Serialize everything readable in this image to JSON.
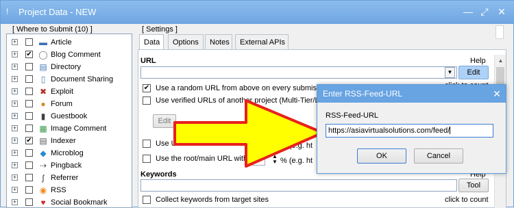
{
  "window": {
    "title": "Project Data - NEW"
  },
  "left_panel": {
    "title": "[ Where to Submit  (10) ]",
    "items": [
      {
        "label": "Article",
        "checked": false,
        "icon": "article-icon"
      },
      {
        "label": "Blog Comment",
        "checked": true,
        "icon": "comment-bubble-icon"
      },
      {
        "label": "Directory",
        "checked": false,
        "icon": "directory-icon"
      },
      {
        "label": "Document Sharing",
        "checked": false,
        "icon": "document-icon"
      },
      {
        "label": "Exploit",
        "checked": false,
        "icon": "exploit-icon"
      },
      {
        "label": "Forum",
        "checked": false,
        "icon": "forum-users-icon"
      },
      {
        "label": "Guestbook",
        "checked": false,
        "icon": "guestbook-icon"
      },
      {
        "label": "Image Comment",
        "checked": false,
        "icon": "image-icon"
      },
      {
        "label": "Indexer",
        "checked": true,
        "icon": "indexer-icon"
      },
      {
        "label": "Microblog",
        "checked": false,
        "icon": "microblog-icon"
      },
      {
        "label": "Pingback",
        "checked": false,
        "icon": "pingback-icon"
      },
      {
        "label": "Referrer",
        "checked": false,
        "icon": "referrer-icon"
      },
      {
        "label": "RSS",
        "checked": false,
        "icon": "rss-icon"
      },
      {
        "label": "Social Bookmark",
        "checked": false,
        "icon": "bookmark-icon"
      }
    ]
  },
  "settings": {
    "title": "[ Settings ]",
    "tabs": [
      "Data",
      "Options",
      "Notes",
      "External APIs"
    ],
    "url_label": "URL",
    "help_1": "Help",
    "edit_button": "Edit",
    "click_to_count_1": "click to count",
    "opt_random_url": "Use a random URL from above on every submissi",
    "opt_verified_urls": "Use verified URLs of another project (Multi-Tier/L",
    "edit_button_2": "Edit",
    "opt_url_variations": "Use U",
    "opt_url_variations_tail": "with",
    "pct_hint_1": "% (e.g. ht",
    "opt_root_url": "Use the root/main URL with",
    "root_pct": "30",
    "pct_hint_2": "% (e.g. ht",
    "keywords_label": "Keywords",
    "help_2": "Help",
    "tool_button": "Tool",
    "opt_collect_keywords": "Collect keywords from target sites",
    "click_to_count_2": "click to count"
  },
  "dialog": {
    "title": "Enter RSS-Feed-URL",
    "label": "RSS-Feed-URL",
    "value": "https://asiavirtualsolutions.com/feed/",
    "ok": "OK",
    "cancel": "Cancel"
  },
  "colors": {
    "titlebar": "#6ea6e2",
    "arrow_fill": "#ffff00",
    "arrow_stroke": "#e8201c",
    "accent_button": "#aed1f7"
  }
}
